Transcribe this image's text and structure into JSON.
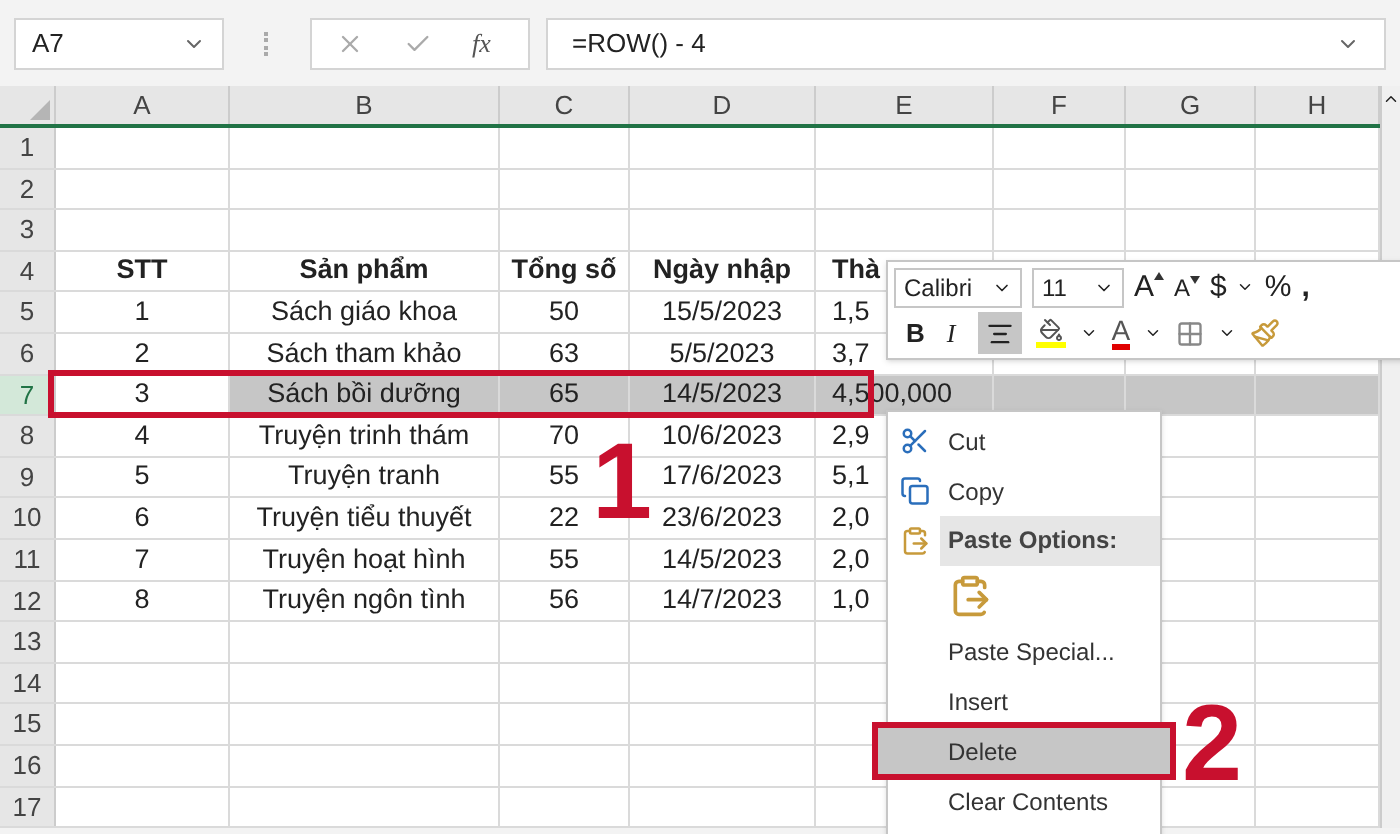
{
  "name_box": {
    "value": "A7"
  },
  "formula_bar": {
    "value": "=ROW() - 4",
    "function_label": "fx"
  },
  "columns": [
    "A",
    "B",
    "C",
    "D",
    "E",
    "F",
    "G",
    "H"
  ],
  "rows": [
    {
      "header": "1",
      "selected": false
    },
    {
      "header": "2",
      "selected": false
    },
    {
      "header": "3",
      "selected": false
    },
    {
      "header": "4",
      "selected": false,
      "kind": "heading",
      "cells": [
        "STT",
        "Sản phẩm",
        "Tổng số",
        "Ngày nhập",
        "Thà"
      ]
    },
    {
      "header": "5",
      "selected": false,
      "cells": [
        "1",
        "Sách giáo khoa",
        "50",
        "15/5/2023",
        "1,5"
      ]
    },
    {
      "header": "6",
      "selected": false,
      "cells": [
        "2",
        "Sách tham khảo",
        "63",
        "5/5/2023",
        "3,7"
      ]
    },
    {
      "header": "7",
      "selected": true,
      "cells": [
        "3",
        "Sách bồi dưỡng",
        "65",
        "14/5/2023",
        "4,500,000"
      ]
    },
    {
      "header": "8",
      "selected": false,
      "cells": [
        "4",
        "Truyện trinh thám",
        "70",
        "10/6/2023",
        "2,9"
      ]
    },
    {
      "header": "9",
      "selected": false,
      "cells": [
        "5",
        "Truyện tranh",
        "55",
        "17/6/2023",
        "5,1"
      ]
    },
    {
      "header": "10",
      "selected": false,
      "cells": [
        "6",
        "Truyện tiểu thuyết",
        "22",
        "23/6/2023",
        "2,0"
      ]
    },
    {
      "header": "11",
      "selected": false,
      "cells": [
        "7",
        "Truyện hoạt hình",
        "55",
        "14/5/2023",
        "2,0"
      ]
    },
    {
      "header": "12",
      "selected": false,
      "cells": [
        "8",
        "Truyện ngôn tình",
        "56",
        "14/7/2023",
        "1,0"
      ]
    },
    {
      "header": "13",
      "selected": false
    },
    {
      "header": "14",
      "selected": false
    },
    {
      "header": "15",
      "selected": false
    },
    {
      "header": "16",
      "selected": false
    },
    {
      "header": "17",
      "selected": false
    }
  ],
  "mini_toolbar": {
    "font": "Calibri",
    "size": "11",
    "grow_label": "A",
    "shrink_label": "A",
    "currency": "$",
    "percent": "%",
    "comma": ",",
    "bold": "B",
    "italic": "I",
    "align_center_selected": true,
    "font_color_label": "A"
  },
  "context_menu": [
    {
      "kind": "item",
      "label": "Cut",
      "selected": false
    },
    {
      "kind": "item",
      "label": "Copy",
      "selected": false
    },
    {
      "kind": "header",
      "label": "Paste Options:"
    },
    {
      "kind": "paste"
    },
    {
      "kind": "item",
      "label": "Paste Special...",
      "selected": false
    },
    {
      "kind": "item",
      "label": "Insert",
      "selected": false
    },
    {
      "kind": "item",
      "label": "Delete",
      "selected": true
    },
    {
      "kind": "item",
      "label": "Clear Contents",
      "selected": false
    }
  ],
  "annotations": [
    {
      "label": "1"
    },
    {
      "label": "2"
    }
  ]
}
